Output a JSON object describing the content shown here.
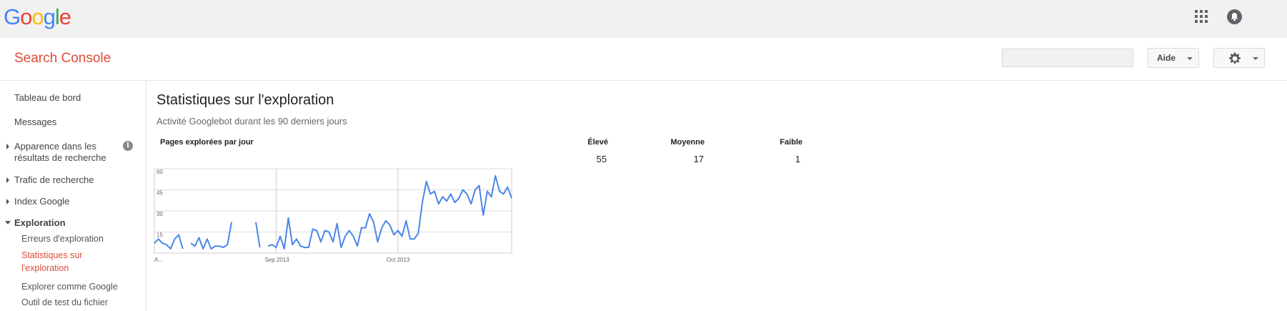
{
  "google_bar": {
    "logo_letters": [
      {
        "ch": "G",
        "color": "#4285f4"
      },
      {
        "ch": "o",
        "color": "#ea4335"
      },
      {
        "ch": "o",
        "color": "#fbbc05"
      },
      {
        "ch": "g",
        "color": "#4285f4"
      },
      {
        "ch": "l",
        "color": "#34a853"
      },
      {
        "ch": "e",
        "color": "#ea4335"
      }
    ],
    "apps_icon": "apps-grid-icon",
    "notification_icon": "bell-icon"
  },
  "header": {
    "product_title": "Search Console",
    "search_placeholder": "",
    "help_label": "Aide",
    "settings_icon": "gear-icon"
  },
  "sidebar": {
    "items": [
      {
        "label": "Tableau de bord"
      },
      {
        "label": "Messages"
      },
      {
        "label_line1": "Apparence dans les",
        "label_line2": "résultats de recherche"
      },
      {
        "label": "Trafic de recherche"
      },
      {
        "label": "Index Google"
      },
      {
        "label": "Exploration"
      }
    ],
    "sub_items": [
      {
        "label": "Erreurs d'exploration"
      },
      {
        "label_line1": "Statistiques sur",
        "label_line2": "l'exploration"
      },
      {
        "label": "Explorer comme Google"
      },
      {
        "label": "Outil de test du fichier"
      }
    ]
  },
  "main": {
    "title": "Statistiques sur l'exploration",
    "subtitle": "Activité Googlebot durant les 90 derniers jours",
    "chart_title": "Pages explorées par jour",
    "stats": [
      {
        "label": "Élevé",
        "value": "55"
      },
      {
        "label": "Moyenne",
        "value": "17"
      },
      {
        "label": "Faible",
        "value": "1"
      }
    ]
  },
  "chart_data": {
    "type": "line",
    "title": "Pages explorées par jour",
    "y_ticks": [
      "60",
      "45",
      "30",
      "15"
    ],
    "ylim": [
      0,
      60
    ],
    "x_tick_labels": [
      "A...",
      "Sep 2013",
      "Oct 2013"
    ],
    "grid": true,
    "line_color": "#4a86e8",
    "values": [
      7,
      10,
      7,
      6,
      3,
      10,
      13,
      3,
      null,
      7,
      5,
      11,
      3,
      10,
      3,
      5,
      5,
      4,
      6,
      22,
      null,
      null,
      null,
      null,
      null,
      22,
      4,
      null,
      5,
      6,
      4,
      12,
      3,
      25,
      6,
      10,
      5,
      4,
      4,
      17,
      16,
      8,
      16,
      15,
      8,
      21,
      4,
      12,
      16,
      12,
      5,
      18,
      18,
      28,
      22,
      8,
      18,
      23,
      20,
      13,
      16,
      12,
      23,
      10,
      10,
      14,
      36,
      51,
      42,
      44,
      35,
      40,
      37,
      42,
      36,
      39,
      45,
      42,
      35,
      45,
      48,
      27,
      44,
      40,
      55,
      44,
      42,
      47,
      39
    ]
  }
}
